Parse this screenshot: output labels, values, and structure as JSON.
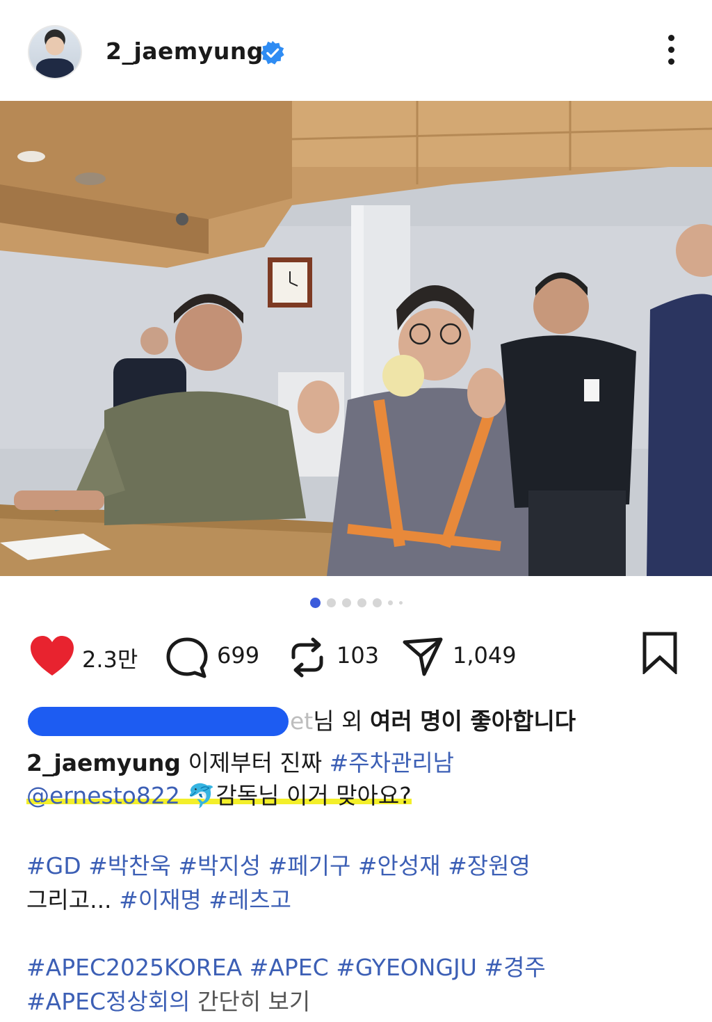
{
  "header": {
    "username": "2_jaemyung",
    "verified": true,
    "icons": {
      "avatar": "profile-avatar",
      "verified": "verified-badge-icon",
      "more": "more-vertical-icon"
    }
  },
  "photo": {
    "alt": "post-photo"
  },
  "carousel": {
    "total": 7,
    "active": 1
  },
  "actions": {
    "like_count": "2.3만",
    "comment_count": "699",
    "repost_count": "103",
    "share_count": "1,049",
    "colors": {
      "like": "#e8232f",
      "accent": "#3c5fb5",
      "highlight": "#f3ef2a",
      "redaction": "#1d5cf2"
    }
  },
  "likes": {
    "partial_name": "et",
    "suffix_text": "님 외 ",
    "bold_text": "여러 명이 좋아합니다"
  },
  "caption": {
    "username": "2_jaemyung",
    "text1": "이제부터 진짜",
    "tag1": "#주차관리남",
    "mention": "@ernesto822",
    "emoji": "🐬",
    "text2": "감독님 이거 맞아요?",
    "tags_line3": [
      "#GD",
      "#박찬욱",
      "#박지성",
      "#페기구",
      "#안성재",
      "#장원영"
    ],
    "text3": "그리고...",
    "tags_line4": [
      "#이재명",
      "#레츠고"
    ],
    "tags_line5": [
      "#APEC2025KOREA",
      "#APEC",
      "#GYEONGJU",
      "#경주"
    ],
    "tag6": "#APEC정상회의",
    "text6": "간단히 보기"
  }
}
